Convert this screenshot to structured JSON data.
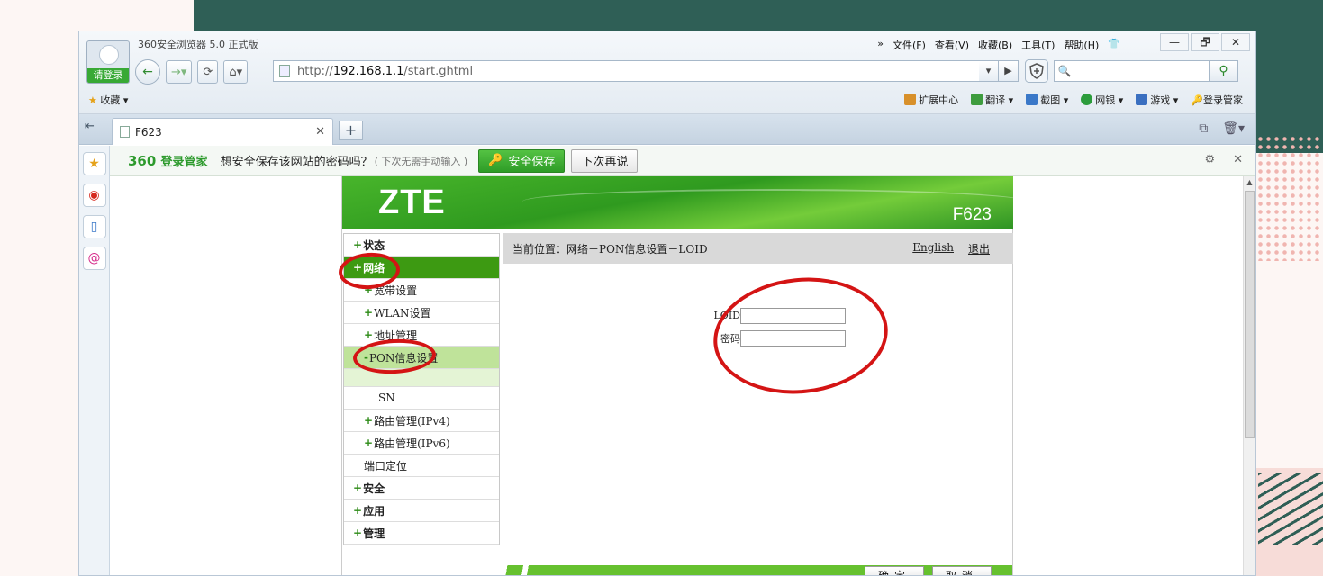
{
  "browser": {
    "app_title": "360安全浏览器 5.0 正式版",
    "login_label": "请登录",
    "menu": [
      "文件(F)",
      "查看(V)",
      "收藏(B)",
      "工具(T)",
      "帮助(H)"
    ],
    "window_buttons": [
      "—",
      "🗗",
      "✕"
    ],
    "address": {
      "scheme": "http://",
      "host": "192.168.1.1",
      "path": "/start.ghtml"
    },
    "search_placeholder": "",
    "bookmarks_label": "收藏",
    "tools": [
      "扩展中心",
      "翻译",
      "截图",
      "网银",
      "游戏",
      "登录管家"
    ],
    "tool_colors": [
      "#d8902a",
      "#3e9c3e",
      "#3a78c8",
      "#2c9c3c",
      "#3a6fc0",
      "#3a6fc0"
    ],
    "tab": {
      "title": "F623"
    }
  },
  "password_bar": {
    "logo": "360",
    "logo_suffix": "登录管家",
    "question": "想安全保存该网站的密码吗？",
    "hint": "( 下次无需手动输入 )",
    "save_label": "安全保存",
    "later_label": "下次再说"
  },
  "router": {
    "brand": "ZTE",
    "model": "F623",
    "breadcrumb": "当前位置：网络－PON信息设置－LOID",
    "links": {
      "english": "English",
      "logout": "退出"
    },
    "nav": [
      {
        "label": "状态",
        "level": "top",
        "prefix": "+"
      },
      {
        "label": "网络",
        "level": "top",
        "prefix": "+",
        "state": "active"
      },
      {
        "label": "宽带设置",
        "level": "sub",
        "prefix": "+"
      },
      {
        "label": "WLAN设置",
        "level": "sub",
        "prefix": "+"
      },
      {
        "label": "地址管理",
        "level": "sub",
        "prefix": "+"
      },
      {
        "label": "PON信息设置",
        "level": "sub",
        "prefix": "-",
        "state": "open"
      },
      {
        "label": "",
        "level": "leaf",
        "prefix": "",
        "state": "selected"
      },
      {
        "label": "SN",
        "level": "leaf",
        "prefix": ""
      },
      {
        "label": "路由管理(IPv4)",
        "level": "sub",
        "prefix": "+"
      },
      {
        "label": "路由管理(IPv6)",
        "level": "sub",
        "prefix": "+"
      },
      {
        "label": "端口定位",
        "level": "sub",
        "prefix": ""
      },
      {
        "label": "安全",
        "level": "top",
        "prefix": "+"
      },
      {
        "label": "应用",
        "level": "top",
        "prefix": "+"
      },
      {
        "label": "管理",
        "level": "top",
        "prefix": "+"
      }
    ],
    "form": {
      "loid_label": "LOID",
      "loid_value": "",
      "password_label": "密码",
      "password_value": ""
    },
    "buttons": {
      "confirm": "确定",
      "cancel": "取消"
    }
  },
  "colors": {
    "annotation": "#d41414",
    "zte_green": "#3d9a12",
    "brand_green": "#2d9a2d"
  }
}
